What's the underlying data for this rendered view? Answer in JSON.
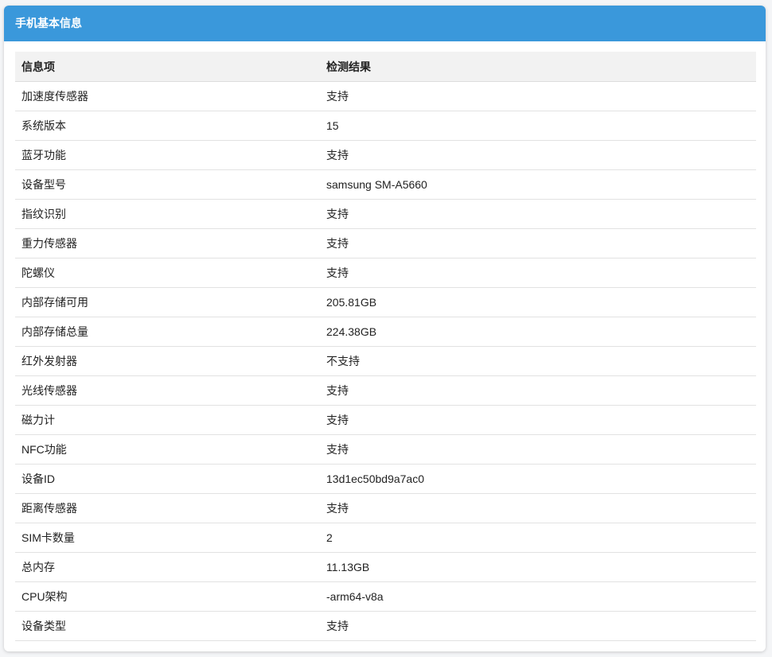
{
  "header": {
    "title": "手机基本信息"
  },
  "table": {
    "columns": [
      "信息项",
      "检测结果"
    ],
    "rows": [
      [
        "加速度传感器",
        "支持"
      ],
      [
        "系统版本",
        "15"
      ],
      [
        "蓝牙功能",
        "支持"
      ],
      [
        "设备型号",
        "samsung SM-A5660"
      ],
      [
        "指纹识别",
        "支持"
      ],
      [
        "重力传感器",
        "支持"
      ],
      [
        "陀螺仪",
        "支持"
      ],
      [
        "内部存储可用",
        "205.81GB"
      ],
      [
        "内部存储总量",
        "224.38GB"
      ],
      [
        "红外发射器",
        "不支持"
      ],
      [
        "光线传感器",
        "支持"
      ],
      [
        "磁力计",
        "支持"
      ],
      [
        "NFC功能",
        "支持"
      ],
      [
        "设备ID",
        "13d1ec50bd9a7ac0"
      ],
      [
        "距离传感器",
        "支持"
      ],
      [
        "SIM卡数量",
        "2"
      ],
      [
        "总内存",
        "11.13GB"
      ],
      [
        "CPU架构",
        "-arm64-v8a"
      ],
      [
        "设备类型",
        "支持"
      ]
    ]
  },
  "colors": {
    "header_bg": "#3a98db",
    "header_text": "#ffffff",
    "table_head_bg": "#f2f2f2"
  }
}
